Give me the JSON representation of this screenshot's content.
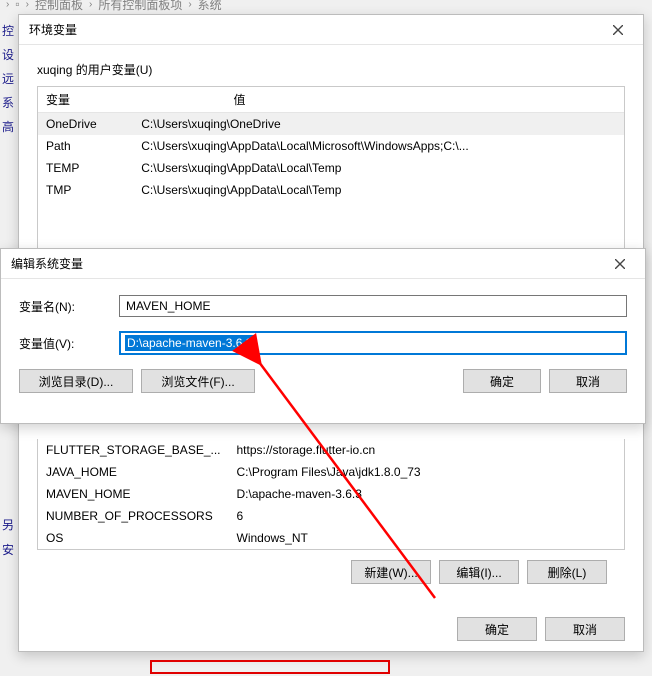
{
  "breadcrumb": {
    "items": [
      "",
      "控制面板",
      "所有控制面板项",
      "系统"
    ]
  },
  "side_nav": [
    "控",
    "设",
    "远",
    "系",
    "高"
  ],
  "side_nav2": [
    "另",
    "安"
  ],
  "env_win": {
    "title": "环境变量",
    "user_section_label": "xuqing 的用户变量(U)",
    "headers": {
      "var": "变量",
      "val": "值"
    },
    "user_vars": [
      {
        "name": "OneDrive",
        "value": "C:\\Users\\xuqing\\OneDrive",
        "sel": true
      },
      {
        "name": "Path",
        "value": "C:\\Users\\xuqing\\AppData\\Local\\Microsoft\\WindowsApps;C:\\...",
        "sel": false
      },
      {
        "name": "TEMP",
        "value": "C:\\Users\\xuqing\\AppData\\Local\\Temp",
        "sel": false
      },
      {
        "name": "TMP",
        "value": "C:\\Users\\xuqing\\AppData\\Local\\Temp",
        "sel": false
      }
    ],
    "sys_vars": [
      {
        "name": "FLUTTER_STORAGE_BASE_...",
        "value": "https://storage.flutter-io.cn"
      },
      {
        "name": "JAVA_HOME",
        "value": "C:\\Program Files\\Java\\jdk1.8.0_73"
      },
      {
        "name": "MAVEN_HOME",
        "value": "D:\\apache-maven-3.6.3"
      },
      {
        "name": "NUMBER_OF_PROCESSORS",
        "value": "6"
      },
      {
        "name": "OS",
        "value": "Windows_NT"
      }
    ],
    "btn_new": "新建(W)...",
    "btn_edit": "编辑(I)...",
    "btn_del": "删除(L)",
    "btn_ok": "确定",
    "btn_cancel": "取消"
  },
  "edit_win": {
    "title": "编辑系统变量",
    "name_label": "变量名(N):",
    "value_label": "变量值(V):",
    "name_value": "MAVEN_HOME",
    "value_value": "D:\\apache-maven-3.6.3",
    "btn_browse_dir": "浏览目录(D)...",
    "btn_browse_file": "浏览文件(F)...",
    "btn_ok": "确定",
    "btn_cancel": "取消"
  }
}
